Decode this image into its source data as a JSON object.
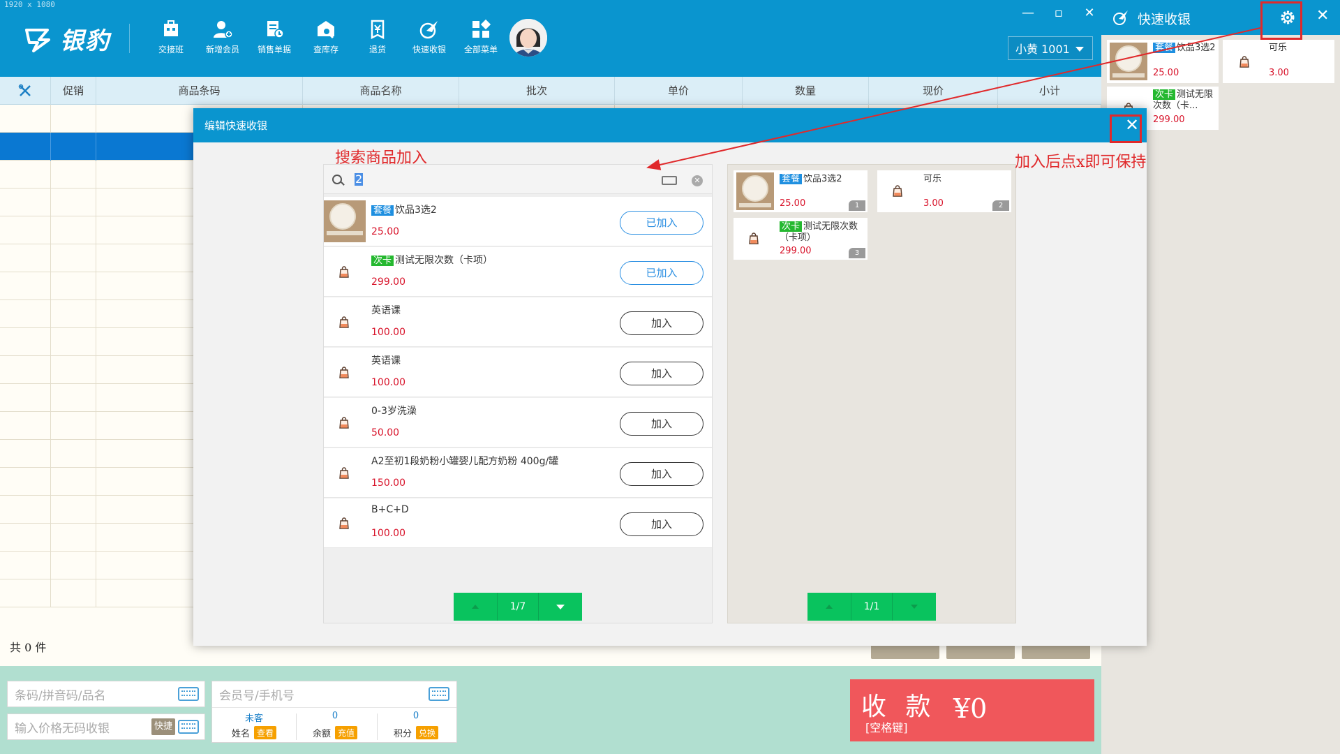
{
  "screen": {
    "resolution_label": "1920 x 1080"
  },
  "app": {
    "brand": "银豹",
    "toolbar": [
      {
        "label": "交接班",
        "icon": "shift-icon"
      },
      {
        "label": "新增会员",
        "icon": "add-member-icon"
      },
      {
        "label": "销售单据",
        "icon": "sales-doc-icon"
      },
      {
        "label": "查库存",
        "icon": "stock-icon"
      },
      {
        "label": "退货",
        "icon": "return-icon"
      },
      {
        "label": "快速收银",
        "icon": "quick-cash-icon"
      },
      {
        "label": "全部菜单",
        "icon": "menu-grid-icon"
      }
    ],
    "user": "小黄 1001",
    "window_controls": [
      "—",
      "▫",
      "✕"
    ]
  },
  "table": {
    "columns": [
      "",
      "促销",
      "商品条码",
      "商品名称",
      "批次",
      "单价",
      "数量",
      "现价",
      "小计"
    ],
    "total": "共 0 件"
  },
  "bottom": {
    "barcode_placeholder": "条码/拼音码/品名",
    "price_placeholder": "输入价格无码收银",
    "kuaijie": "快捷",
    "member_placeholder": "会员号/手机号",
    "member_cells": [
      {
        "value": "未客",
        "label": "姓名",
        "action": "查看"
      },
      {
        "value": "0",
        "label": "余额",
        "action": "充值"
      },
      {
        "value": "0",
        "label": "积分",
        "action": "兑换"
      }
    ],
    "pay": {
      "line1": "收 款",
      "line2": "[空格键]",
      "amount": "¥0"
    }
  },
  "side_panel": {
    "title": "快速收银",
    "items": [
      {
        "tag": "套餐",
        "tag_color": "#1e8fe0",
        "name": "饮品3选2",
        "price": "25.00",
        "thumb": "food"
      },
      {
        "tag": "",
        "tag_color": "",
        "name": "可乐",
        "price": "3.00",
        "thumb": "bag"
      },
      {
        "tag": "次卡",
        "tag_color": "#25b830",
        "name": "测试无限次数（卡...",
        "price": "299.00",
        "thumb": "bag"
      }
    ]
  },
  "modal": {
    "title": "编辑快速收银",
    "search_value": "2",
    "products": [
      {
        "tag": "套餐",
        "tag_color": "#1e8fe0",
        "name": "饮品3选2",
        "price": "25.00",
        "action": "已加入",
        "added": true,
        "thumb": "food"
      },
      {
        "tag": "次卡",
        "tag_color": "#25b830",
        "name": "测试无限次数（卡项）",
        "price": "299.00",
        "action": "已加入",
        "added": true,
        "thumb": "bag"
      },
      {
        "tag": "",
        "tag_color": "",
        "name": "英语课",
        "price": "100.00",
        "action": "加入",
        "added": false,
        "thumb": "bag"
      },
      {
        "tag": "",
        "tag_color": "",
        "name": "英语课",
        "price": "100.00",
        "action": "加入",
        "added": false,
        "thumb": "bag"
      },
      {
        "tag": "",
        "tag_color": "",
        "name": "0-3岁洗澡",
        "price": "50.00",
        "action": "加入",
        "added": false,
        "thumb": "bag"
      },
      {
        "tag": "",
        "tag_color": "",
        "name": "A2至初1段奶粉小罐婴儿配方奶粉 400g/罐",
        "price": "150.00",
        "action": "加入",
        "added": false,
        "thumb": "bag"
      },
      {
        "tag": "",
        "tag_color": "",
        "name": "B+C+D",
        "price": "100.00",
        "action": "加入",
        "added": false,
        "thumb": "bag"
      }
    ],
    "left_pager": "1/7",
    "selected": [
      {
        "tag": "套餐",
        "tag_color": "#1e8fe0",
        "name": "饮品3选2",
        "price": "25.00",
        "index": "1",
        "thumb": "food"
      },
      {
        "tag": "",
        "tag_color": "",
        "name": "可乐",
        "price": "3.00",
        "index": "2",
        "thumb": "bag"
      },
      {
        "tag": "次卡",
        "tag_color": "#25b830",
        "name": "测试无限次数（卡项）",
        "price": "299.00",
        "index": "3",
        "thumb": "bag"
      }
    ],
    "right_pager": "1/1"
  },
  "annotations": {
    "search_hint": "搜索商品加入",
    "close_hint": "加入后点x即可保持"
  },
  "colors": {
    "primary": "#0a95cf",
    "pay": "#f0575b",
    "price": "#d8132a",
    "pager": "#09c35e",
    "annotation": "#e0292b"
  }
}
